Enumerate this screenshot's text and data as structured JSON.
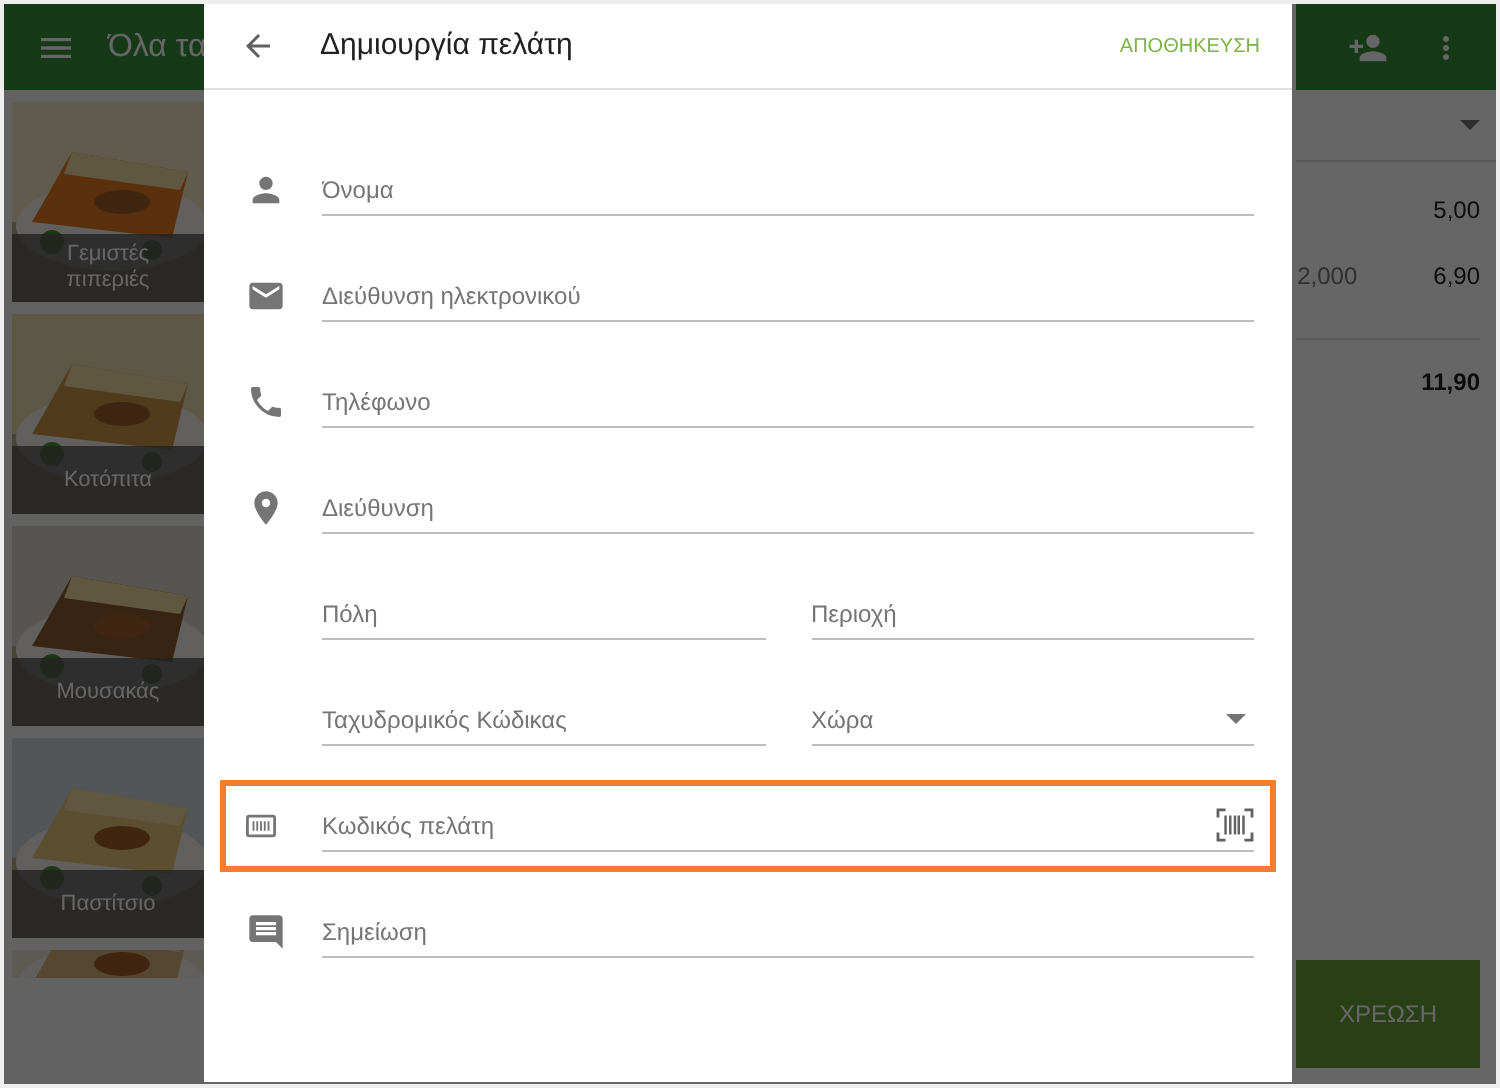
{
  "background_app": {
    "header_title": "Όλα τα",
    "products": [
      {
        "name": "Γεμιστές πιπεριές"
      },
      {
        "name": "Κοτόπιτα"
      },
      {
        "name": "Μουσακάς"
      },
      {
        "name": "Παστίτσιο"
      },
      {
        "kind": "picture"
      }
    ],
    "order_lines": [
      {
        "amount": "5,00"
      },
      {
        "quantity": "2,000",
        "amount": "6,90"
      }
    ],
    "total": "11,90",
    "charge_button": "ΧΡΕΩΣΗ"
  },
  "dialog": {
    "title": "Δημιουργία πελάτη",
    "save_button": "ΑΠΟΘΗΚΕΥΣΗ",
    "rows": [
      {
        "kind": "text",
        "placeholder": "Όνομα",
        "highlighted": false
      },
      {
        "kind": "text",
        "placeholder": "Διεύθυνση ηλεκτρονικού",
        "highlighted": false
      },
      {
        "kind": "text",
        "placeholder": "Τηλέφωνο",
        "highlighted": false
      },
      {
        "kind": "text",
        "placeholder": "Διεύθυνση",
        "highlighted": false
      },
      {
        "kind": "pair",
        "highlighted": false,
        "fields": [
          {
            "kind": "text",
            "placeholder": "Πόλη"
          },
          {
            "kind": "text",
            "placeholder": "Περιοχή"
          }
        ]
      },
      {
        "kind": "pair",
        "highlighted": false,
        "fields": [
          {
            "kind": "text",
            "placeholder": "Ταχυδρομικός Κώδικας"
          },
          {
            "kind": "select",
            "placeholder": "Χώρα"
          }
        ]
      },
      {
        "kind": "scan",
        "placeholder": "Κωδικός πελάτη",
        "highlighted": true
      },
      {
        "kind": "text",
        "placeholder": "Σημείωση",
        "highlighted": false
      }
    ]
  }
}
